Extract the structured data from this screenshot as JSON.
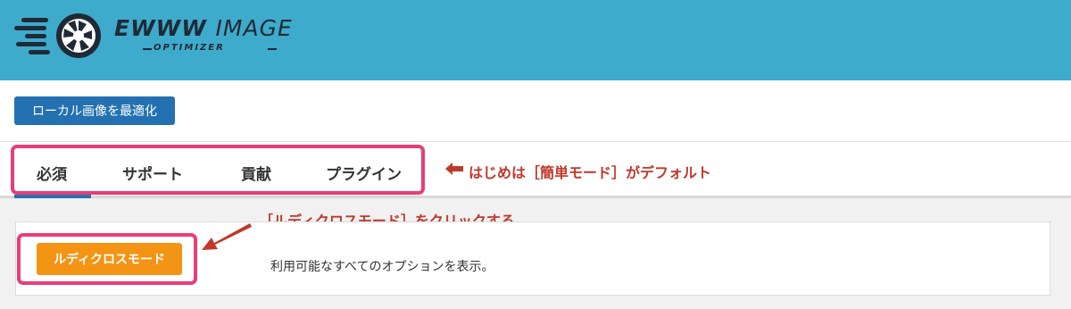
{
  "colors": {
    "header_bg": "#3eabcc",
    "primary": "#2471b1",
    "orange": "#f39414",
    "highlight": "#e93d78",
    "annotation": "#c0392b"
  },
  "logo": {
    "brand": "EWWW",
    "word": "IMAGE",
    "sub": "OPTIMIZER",
    "icon": "camera-aperture-icon"
  },
  "toolbar": {
    "optimize_label": "ローカル画像を最適化"
  },
  "tabs": [
    {
      "label": "必須"
    },
    {
      "label": "サポート"
    },
    {
      "label": "貢献"
    },
    {
      "label": "プラグイン"
    }
  ],
  "annotations": {
    "tabs_note": "はじめは［簡単モード］がデフォルト",
    "button_note": "［ルディクロスモード］をクリックする"
  },
  "panel": {
    "ludicrous_label": "ルディクロスモード",
    "description": "利用可能なすべてのオプションを表示。"
  }
}
